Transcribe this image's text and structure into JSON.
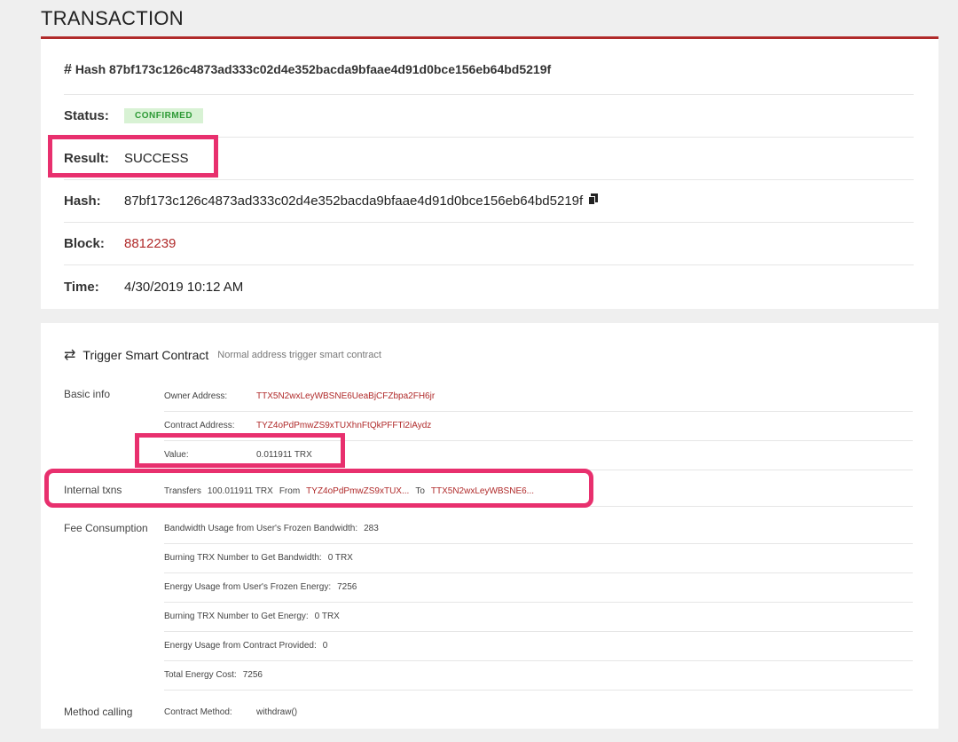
{
  "page": {
    "title": "TRANSACTION"
  },
  "summary": {
    "hash_title_prefix": "#",
    "hash_title": "Hash 87bf173c126c4873ad333c02d4e352bacda9bfaae4d91d0bce156eb64bd5219f",
    "status_label": "Status:",
    "status_value": "CONFIRMED",
    "result_label": "Result:",
    "result_value": "SUCCESS",
    "hash_label": "Hash:",
    "hash_value": "87bf173c126c4873ad333c02d4e352bacda9bfaae4d91d0bce156eb64bd5219f",
    "block_label": "Block:",
    "block_value": "8812239",
    "time_label": "Time:",
    "time_value": "4/30/2019 10:12 AM"
  },
  "contract": {
    "title": "Trigger Smart Contract",
    "subtitle": "Normal address trigger smart contract",
    "basic_info_label": "Basic info",
    "owner_label": "Owner Address:",
    "owner_value": "TTX5N2wxLeyWBSNE6UeaBjCFZbpa2FH6jr",
    "contract_addr_label": "Contract Address:",
    "contract_addr_value": "TYZ4oPdPmwZS9xTUXhnFtQkPFFTi2iAydz",
    "value_label": "Value:",
    "value_value": "0.011911 TRX",
    "internal_label": "Internal txns",
    "transfers_label": "Transfers",
    "transfers_amount": "100.011911 TRX",
    "from_label": "From",
    "from_addr": "TYZ4oPdPmwZS9xTUX...",
    "to_label": "To",
    "to_addr": "TTX5N2wxLeyWBSNE6...",
    "fee_label": "Fee Consumption",
    "fees": [
      {
        "label": "Bandwidth Usage from User's Frozen Bandwidth:",
        "value": "283"
      },
      {
        "label": "Burning TRX Number to Get Bandwidth:",
        "value": "0 TRX"
      },
      {
        "label": "Energy Usage from User's Frozen Energy:",
        "value": "7256"
      },
      {
        "label": "Burning TRX Number to Get Energy:",
        "value": "0 TRX"
      },
      {
        "label": "Energy Usage from Contract Provided:",
        "value": "0"
      },
      {
        "label": "Total Energy Cost:",
        "value": "7256"
      }
    ],
    "method_label": "Method calling",
    "method_key": "Contract Method:",
    "method_value": "withdraw()"
  },
  "icons": {
    "copy": "copy-icon",
    "trigger": "swap-arrows-icon"
  },
  "colors": {
    "accent_red": "#b02a2a",
    "highlight_pink": "#e8306e",
    "status_green_bg": "#d8f2d4",
    "status_green_text": "#2e9a36"
  }
}
